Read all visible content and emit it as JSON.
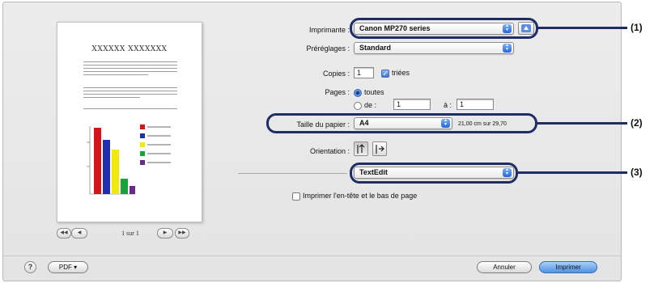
{
  "preview": {
    "doc_title": "XXXXXX XXXXXXX",
    "page_label": "1 sur 1",
    "nav": {
      "first": "◀◀",
      "prev": "◀",
      "next": "▶",
      "last": "▶▶"
    }
  },
  "form": {
    "printer": {
      "label": "Imprimante :",
      "value": "Canon MP270 series"
    },
    "presets": {
      "label": "Préréglages :",
      "value": "Standard"
    },
    "copies": {
      "label": "Copies :",
      "value": "1",
      "collate_label": "triées"
    },
    "pages": {
      "label": "Pages :",
      "all_label": "toutes",
      "from_label": "de :",
      "from_value": "1",
      "to_label": "à :",
      "to_value": "1"
    },
    "paper": {
      "label": "Taille du papier :",
      "value": "A4",
      "dimensions": "21,00 cm sur 29,70"
    },
    "orientation": {
      "label": "Orientation :"
    },
    "app_menu": {
      "value": "TextEdit"
    },
    "header_footer": {
      "label": "Imprimer l'en-tête et le bas de page"
    }
  },
  "callouts": {
    "c1": "(1)",
    "c2": "(2)",
    "c3": "(3)"
  },
  "footer": {
    "help": "?",
    "pdf": "PDF ▾",
    "cancel": "Annuler",
    "print": "Imprimer"
  },
  "colors": {
    "callout": "#1e2d66",
    "accent": "#3673da"
  }
}
